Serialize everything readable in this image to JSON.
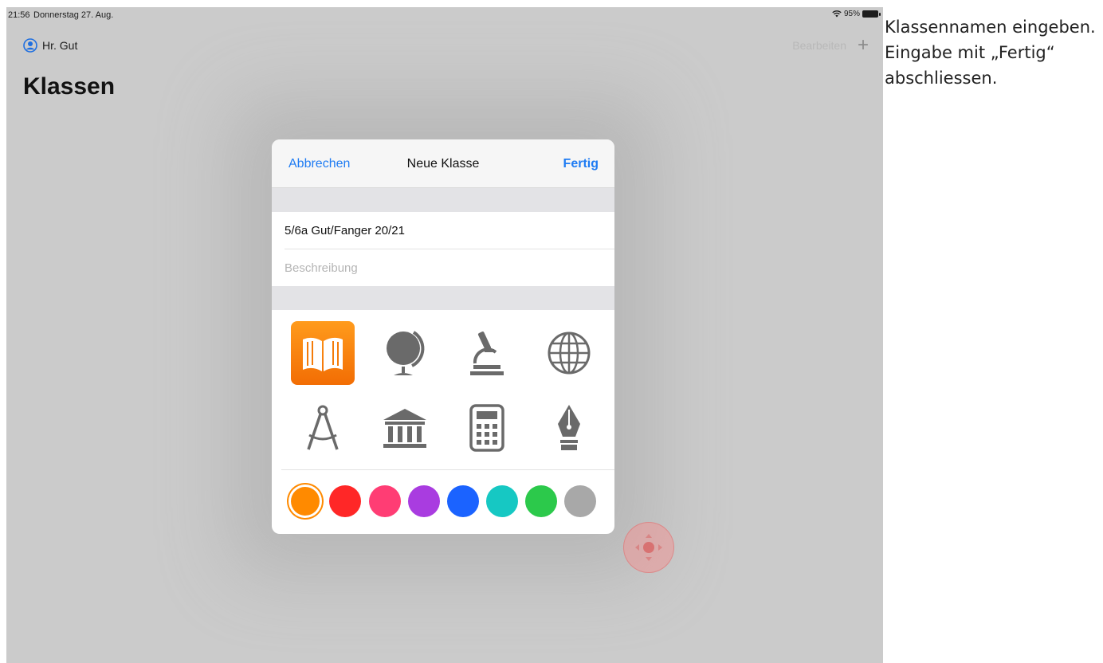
{
  "status_bar": {
    "time": "21:56",
    "date": "Donnerstag 27. Aug.",
    "battery": "95%",
    "wifi_icon": "wifi-icon"
  },
  "nav": {
    "user": "Hr. Gut",
    "edit": "Bearbeiten",
    "add_icon": "plus-icon"
  },
  "page_title": "Klassen",
  "modal": {
    "cancel": "Abbrechen",
    "title": "Neue Klasse",
    "done": "Fertig",
    "name_value": "5/6a Gut/Fanger 20/21",
    "description_placeholder": "Beschreibung",
    "icons": [
      "book-icon",
      "globe-icon",
      "microscope-icon",
      "world-grid-icon",
      "compass-icon",
      "museum-icon",
      "calculator-icon",
      "fountain-pen-icon"
    ],
    "selected_icon": "book-icon",
    "colors": [
      "#ff8a00",
      "#ff2727",
      "#ff3d74",
      "#a93ce0",
      "#1b63ff",
      "#16c8c3",
      "#2cc94b",
      "#a8a8a8"
    ],
    "selected_color": "#ff8a00"
  },
  "caption": "Klassennamen eingeben. Eingabe mit „Fertig“ abschliessen."
}
